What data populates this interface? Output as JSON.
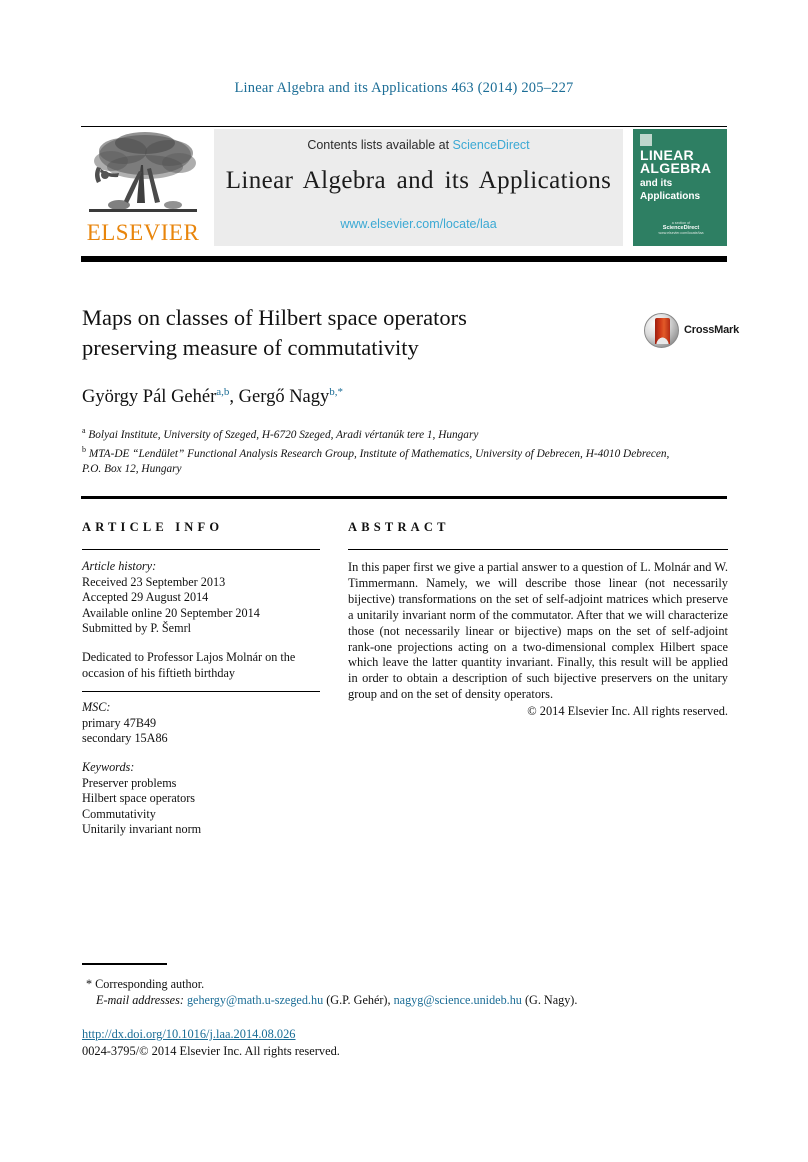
{
  "running_head": "Linear Algebra and its Applications 463 (2014) 205–227",
  "masthead": {
    "publisher_name": "ELSEVIER",
    "contents_prefix": "Contents lists available at ",
    "contents_link": "ScienceDirect",
    "journal_title": "Linear Algebra and its Applications",
    "journal_url": "www.elsevier.com/locate/laa",
    "cover": {
      "line1": "LINEAR",
      "line2": "ALGEBRA",
      "line3": "and its",
      "line4": "Applications",
      "footer_small": "a section of",
      "footer_brand": "ScienceDirect",
      "footer_tiny": "www.elsevier.com/locate/laa"
    }
  },
  "article": {
    "title_line1": "Maps on classes of Hilbert space operators",
    "title_line2": "preserving measure of commutativity",
    "crossmark_label": "CrossMark",
    "authors_text": "György Pál Gehér",
    "author1_sup": "a,b",
    "authors_sep": ", ",
    "author2_text": "Gergő Nagy",
    "author2_sup": "b,*",
    "affiliation_a_sup": "a",
    "affiliation_a": " Bolyai Institute, University of Szeged, H-6720 Szeged, Aradi vértanúk tere 1, Hungary",
    "affiliation_b_sup": "b",
    "affiliation_b": " MTA-DE “Lendület” Functional Analysis Research Group, Institute of Mathematics, University of Debrecen, H-4010 Debrecen, P.O. Box 12, Hungary"
  },
  "info": {
    "heading": "ARTICLE INFO",
    "history_label": "Article history:",
    "history": [
      "Received 23 September 2013",
      "Accepted 29 August 2014",
      "Available online 20 September 2014",
      "Submitted by P. Šemrl"
    ],
    "dedication": "Dedicated to Professor Lajos Molnár on the occasion of his fiftieth birthday",
    "msc_label": "MSC:",
    "msc": [
      "primary 47B49",
      "secondary 15A86"
    ],
    "keywords_label": "Keywords:",
    "keywords": [
      "Preserver problems",
      "Hilbert space operators",
      "Commutativity",
      "Unitarily invariant norm"
    ]
  },
  "abstract": {
    "heading": "ABSTRACT",
    "text": "In this paper first we give a partial answer to a question of L. Molnár and W. Timmermann. Namely, we will describe those linear (not necessarily bijective) transformations on the set of self-adjoint matrices which preserve a unitarily invariant norm of the commutator. After that we will characterize those (not necessarily linear or bijective) maps on the set of self-adjoint rank-one projections acting on a two-dimensional complex Hilbert space which leave the latter quantity invariant. Finally, this result will be applied in order to obtain a description of such bijective preservers on the unitary group and on the set of density operators.",
    "copyright": "© 2014 Elsevier Inc. All rights reserved."
  },
  "footnotes": {
    "corresponding": "* Corresponding author.",
    "email_label": "E-mail addresses:",
    "email1": "gehergy@math.u-szeged.hu",
    "email1_owner": "(G.P. Gehér),",
    "email2": "nagyg@science.unideb.hu",
    "email2_owner": "(G. Nagy)."
  },
  "footer": {
    "doi": "http://dx.doi.org/10.1016/j.laa.2014.08.026",
    "copyright": "0024-3795/© 2014 Elsevier Inc. All rights reserved."
  },
  "colors": {
    "link_blue": "#1b6d96",
    "sd_blue": "#3ba9d4",
    "elsevier_orange": "#e8850c",
    "cover_green": "#2e7f63"
  }
}
